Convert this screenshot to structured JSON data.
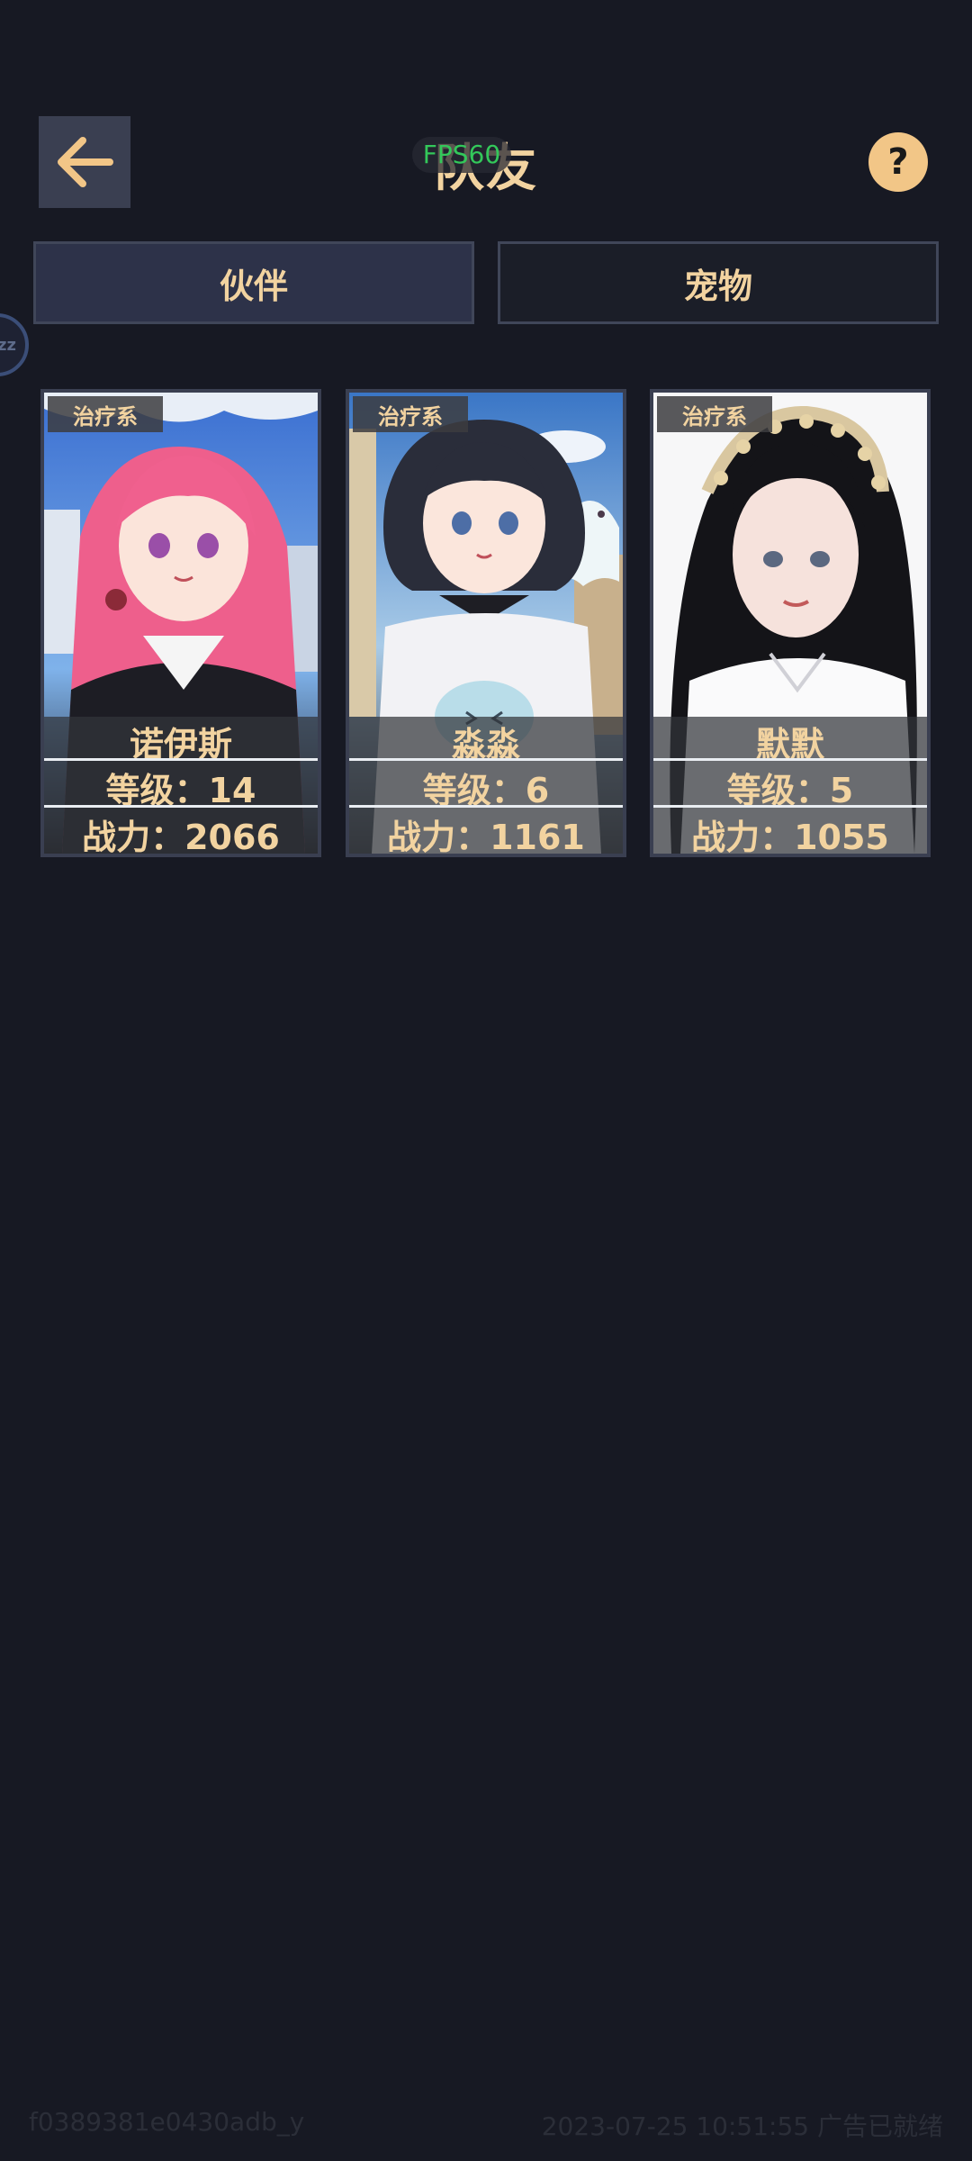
{
  "header": {
    "title": "队友",
    "fps_label": "FPS60",
    "help_label": "?"
  },
  "tabs": [
    {
      "label": "伙伴",
      "selected": true
    },
    {
      "label": "宠物",
      "selected": false
    }
  ],
  "floating_bubble": {
    "label": "zz"
  },
  "cards": [
    {
      "element": "治疗系",
      "name": "诺伊斯",
      "level": "等级：14",
      "power": "战力：2066"
    },
    {
      "element": "治疗系",
      "name": "淼淼",
      "level": "等级：6",
      "power": "战力：1161"
    },
    {
      "element": "治疗系",
      "name": "默默",
      "level": "等级：5",
      "power": "战力：1055"
    }
  ],
  "footer": {
    "device_id": "f0389381e0430adb_y",
    "status": "2023-07-25 10:51:55 广告已就绪"
  },
  "colors": {
    "background": "#171923",
    "accent_text": "#f2d3a0",
    "tab_selected": "#2d3249",
    "help_button": "#f2c687",
    "fps_text": "#33c85a"
  }
}
